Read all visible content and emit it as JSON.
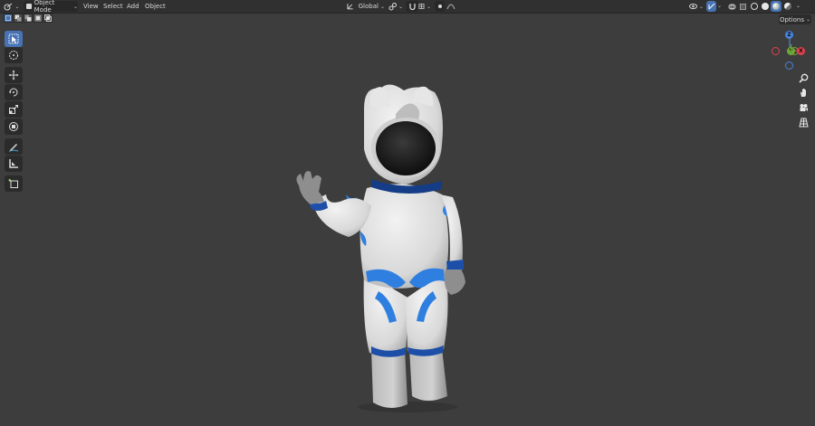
{
  "header": {
    "mode": "Object Mode",
    "menus": [
      "View",
      "Select",
      "Add",
      "Object"
    ],
    "transform_orientation": "Global"
  },
  "viewport": {
    "options_label": "Options",
    "gizmo": {
      "x": "X",
      "y": "Y",
      "z": "Z"
    }
  },
  "colors": {
    "accent": "#4772b3",
    "header_bg": "#303030",
    "viewport_bg": "#3d3d3d",
    "axis_x": "#e0414d",
    "axis_y": "#6ea835",
    "axis_z": "#4684e0"
  },
  "icons": {
    "toolbar": [
      "select-box-icon",
      "cursor-icon",
      "move-icon",
      "rotate-icon",
      "scale-icon",
      "transform-icon",
      "annotate-icon",
      "measure-icon",
      "add-cube-icon"
    ],
    "navigation": [
      "zoom-icon",
      "pan-hand-icon",
      "camera-icon",
      "grid-icon"
    ]
  }
}
